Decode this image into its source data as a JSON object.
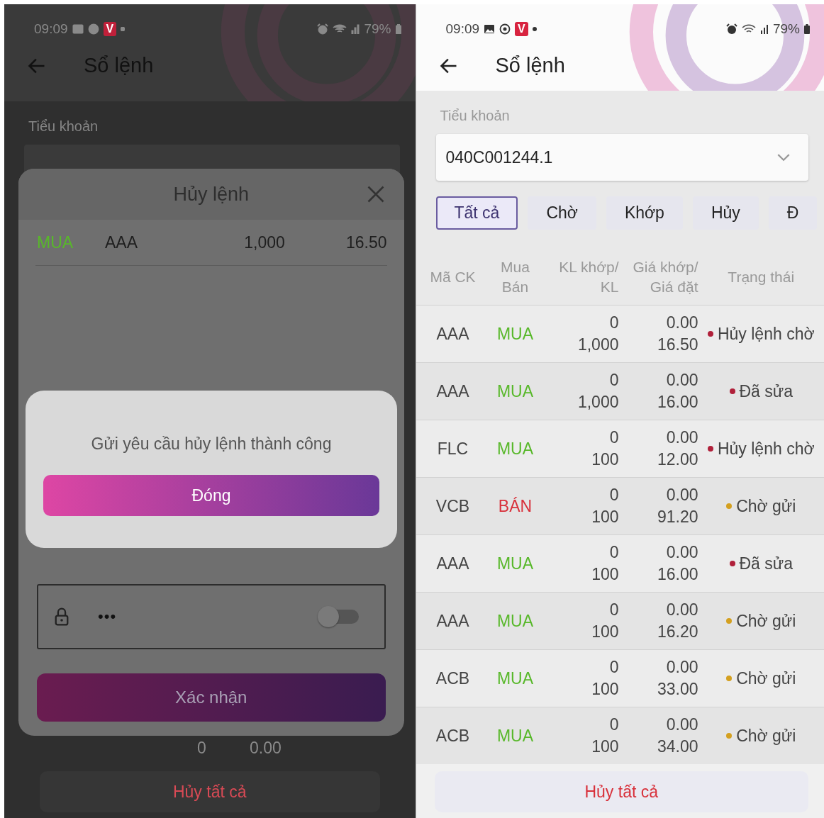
{
  "left_screen": {
    "status_bar": {
      "time": "09:09",
      "app_badge": "V",
      "battery": "79%"
    },
    "header": {
      "title": "Sổ lệnh"
    },
    "account": {
      "label": "Tiểu khoản"
    },
    "background_row": {
      "column_3": "0",
      "column_4": "0.00"
    },
    "cancel_all_button": "Hủy tất cả",
    "cancel_sheet": {
      "title": "Hủy lệnh",
      "order": {
        "side": {
          "text": "MUA",
          "color": "#58b82a"
        },
        "symbol": "AAA",
        "quantity": "1,000",
        "price": "16.50"
      },
      "password": {
        "value": "•••",
        "show_password": false
      },
      "confirm_button": "Xác nhận"
    },
    "success_dialog": {
      "message": "Gửi yêu cầu hủy lệnh thành công",
      "close_button": "Đóng"
    }
  },
  "right_screen": {
    "status_bar": {
      "time": "09:09",
      "app_badge": "V",
      "battery": "79%"
    },
    "header": {
      "title": "Sổ lệnh"
    },
    "account": {
      "label": "Tiểu khoản",
      "value": "040C001244.1"
    },
    "tabs": [
      {
        "label": "Tất cả",
        "selected": true
      },
      {
        "label": "Chờ",
        "selected": false
      },
      {
        "label": "Khớp",
        "selected": false
      },
      {
        "label": "Hủy",
        "selected": false
      },
      {
        "label": "Đ",
        "selected": false
      }
    ],
    "table": {
      "columns": [
        "Mã CK",
        "Mua\nBán",
        "KL khớp/\nKL",
        "Giá khớp/\nGiá đặt",
        "Trạng thái"
      ],
      "rows": [
        {
          "symbol": "AAA",
          "side": {
            "text": "MUA",
            "color": "#58b82a"
          },
          "matched_qty": "0",
          "order_qty": "1,000",
          "matched_price": "0.00",
          "order_price": "16.50",
          "status": "Hủy lệnh chờ",
          "color": "#b0203a"
        },
        {
          "symbol": "AAA",
          "side": {
            "text": "MUA",
            "color": "#58b82a"
          },
          "matched_qty": "0",
          "order_qty": "1,000",
          "matched_price": "0.00",
          "order_price": "16.00",
          "status": "Đã sửa",
          "color": "#b0203a"
        },
        {
          "symbol": "FLC",
          "side": {
            "text": "MUA",
            "color": "#58b82a"
          },
          "matched_qty": "0",
          "order_qty": "100",
          "matched_price": "0.00",
          "order_price": "12.00",
          "status": "Hủy lệnh chờ",
          "color": "#b0203a"
        },
        {
          "symbol": "VCB",
          "side": {
            "text": "BÁN",
            "color": "#d8303a"
          },
          "matched_qty": "0",
          "order_qty": "100",
          "matched_price": "0.00",
          "order_price": "91.20",
          "status": "Chờ gửi",
          "color": "#d4a020"
        },
        {
          "symbol": "AAA",
          "side": {
            "text": "MUA",
            "color": "#58b82a"
          },
          "matched_qty": "0",
          "order_qty": "100",
          "matched_price": "0.00",
          "order_price": "16.00",
          "status": "Đã sửa",
          "color": "#b0203a"
        },
        {
          "symbol": "AAA",
          "side": {
            "text": "MUA",
            "color": "#58b82a"
          },
          "matched_qty": "0",
          "order_qty": "100",
          "matched_price": "0.00",
          "order_price": "16.20",
          "status": "Chờ gửi",
          "color": "#d4a020"
        },
        {
          "symbol": "ACB",
          "side": {
            "text": "MUA",
            "color": "#58b82a"
          },
          "matched_qty": "0",
          "order_qty": "100",
          "matched_price": "0.00",
          "order_price": "33.00",
          "status": "Chờ gửi",
          "color": "#d4a020"
        },
        {
          "symbol": "ACB",
          "side": {
            "text": "MUA",
            "color": "#58b82a"
          },
          "matched_qty": "0",
          "order_qty": "100",
          "matched_price": "0.00",
          "order_price": "34.00",
          "status": "Chờ gửi",
          "color": "#d4a020"
        }
      ]
    },
    "cancel_all_button": "Hủy tất cả"
  }
}
